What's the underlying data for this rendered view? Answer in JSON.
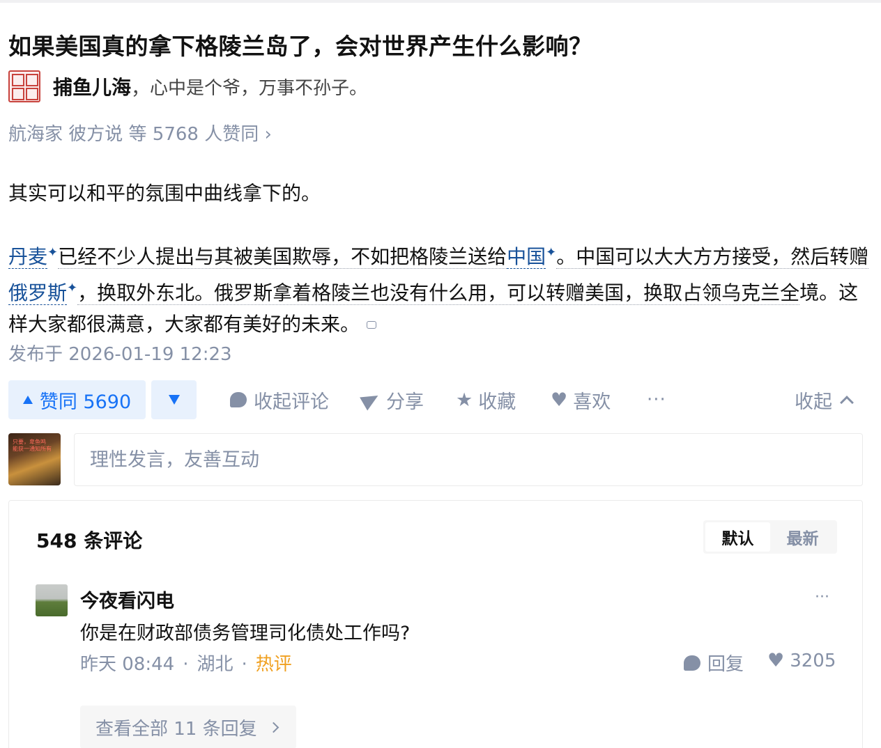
{
  "question": {
    "title": "如果美国真的拿下格陵兰岛了，会对世界产生什么影响？"
  },
  "author": {
    "name": "捕鱼儿海",
    "separator": "，",
    "bio": "心中是个爷，万事不孙子。"
  },
  "voters_text": "航海家 彼方说 等 5768 人赞同 ›",
  "answer": {
    "para1": "其实可以和平的氛围中曲线拿下的。",
    "para2": {
      "link_denmark": "丹麦",
      "seg1": "已经不少人提出与其被美国欺辱，不如把格陵兰送给",
      "link_china": "中国",
      "seg2": "。中国可以大大方方接受，然后转赠",
      "link_russia": "俄罗斯",
      "seg3": "，换取外东北。俄罗斯拿着格陵兰也没有什么用，可以转赠美国，换取占领乌克兰全",
      "seg4": "境。这样大家都很满意，大家都有美好的未来。"
    },
    "spark": "✦",
    "published": "发布于 2026-01-19 12:23"
  },
  "actions": {
    "vote_up": "赞同 5690",
    "collapse_comments": "收起评论",
    "share": "分享",
    "favorite": "收藏",
    "like": "喜欢",
    "more": "···",
    "collapse": "收起"
  },
  "my_avatar_text": "只要，卑鱼鸣\n能获一通知所有",
  "comment_input": {
    "placeholder": "理性发言，友善互动"
  },
  "comments": {
    "count_title": "548 条评论",
    "sort_default": "默认",
    "sort_latest": "最新",
    "items": [
      {
        "user": "今夜看闪电",
        "text": "你是在财政部债务管理司化债处工作吗?",
        "time": "昨天 08:44",
        "location": "湖北",
        "hot": "热评",
        "reply_label": "回复",
        "likes": "3205",
        "more": "···",
        "view_all": "查看全部 11 条回复"
      }
    ]
  },
  "colors": {
    "link": "#175199",
    "accent": "#1772f6",
    "muted": "#8590a6",
    "hot": "#f0a020"
  }
}
